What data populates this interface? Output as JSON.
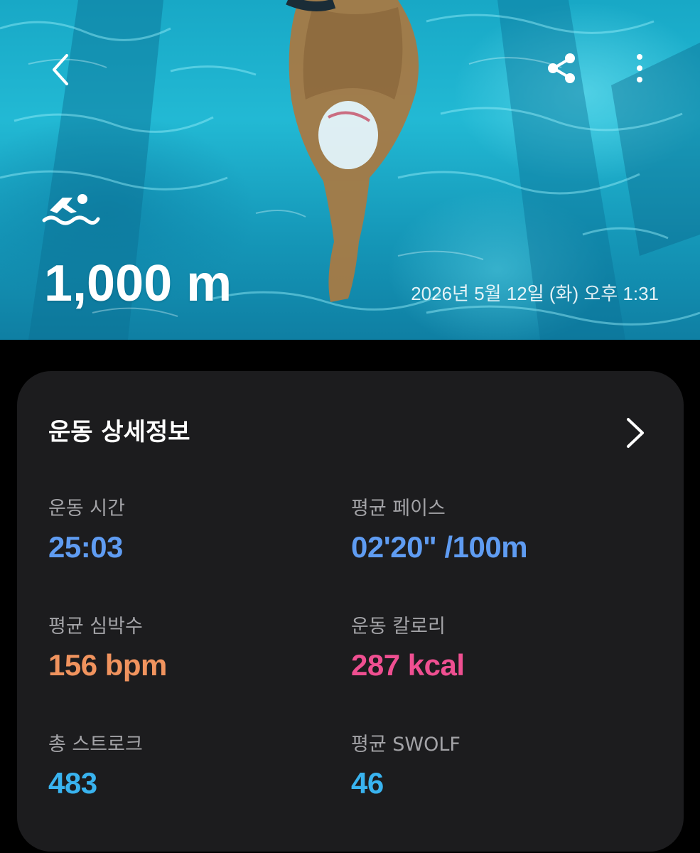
{
  "header": {
    "distance": "1,000 m",
    "datetime": "2026년 5월 12일 (화) 오후 1:31",
    "activity_icon": "swimming-icon",
    "back_icon": "back-chevron-icon",
    "share_icon": "share-icon",
    "more_icon": "more-vertical-icon"
  },
  "details": {
    "title": "운동 상세정보",
    "arrow_icon": "chevron-right-icon",
    "stats": [
      {
        "label": "운동 시간",
        "value": "25:03",
        "color": "#5f9cf2"
      },
      {
        "label": "평균 페이스",
        "value": "02'20\" /100m",
        "color": "#5f9cf2"
      },
      {
        "label": "평균 심박수",
        "value": "156 bpm",
        "color": "#f0935e"
      },
      {
        "label": "운동 칼로리",
        "value": "287 kcal",
        "color": "#ef4f91"
      },
      {
        "label": "총 스트로크",
        "value": "483",
        "color": "#39b3ef"
      },
      {
        "label": "평균 SWOLF",
        "value": "46",
        "color": "#39b3ef"
      }
    ]
  },
  "colors": {
    "card_background": "#1c1c1e",
    "page_background": "#000000",
    "label_gray": "#a3a3a7"
  }
}
